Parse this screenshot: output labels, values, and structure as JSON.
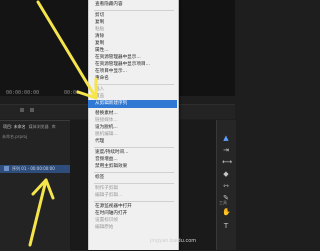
{
  "monitor": {
    "timecode_left": "00:00:00:00",
    "timecode_right": "00:00"
  },
  "project_panel": {
    "tabs": [
      "项目: 未命名",
      "媒体浏览器",
      "库"
    ],
    "project_file": "未命名.prproj",
    "sequence_label": "序列 01 - 00:00:00:00"
  },
  "context_menu": {
    "items": [
      {
        "label": "查看隐藏内容",
        "disabled": false
      },
      {
        "label": "剪切",
        "disabled": false
      },
      {
        "label": "复制",
        "disabled": false
      },
      {
        "label": "粘贴",
        "disabled": true
      },
      {
        "label": "清除",
        "disabled": false
      },
      {
        "label": "复制",
        "disabled": false
      },
      {
        "label": "属性...",
        "disabled": false
      },
      {
        "label": "在资源管理器中显示...",
        "disabled": false
      },
      {
        "label": "在资源管理器中显示项目...",
        "disabled": false
      },
      {
        "label": "在项目中显示...",
        "disabled": false
      },
      {
        "label": "重命名",
        "disabled": false
      },
      {
        "label": "插入",
        "disabled": true
      },
      {
        "label": "覆盖",
        "disabled": true
      },
      {
        "label": "从剪辑新建序列",
        "disabled": false,
        "highlight": true
      },
      {
        "label": "替换素材...",
        "disabled": false
      },
      {
        "label": "链接媒体...",
        "disabled": true
      },
      {
        "label": "设为脱机...",
        "disabled": false
      },
      {
        "label": "脱机编辑...",
        "disabled": true
      },
      {
        "label": "代理",
        "disabled": false
      },
      {
        "label": "速度/持续时间...",
        "disabled": false
      },
      {
        "label": "音频增益...",
        "disabled": false
      },
      {
        "label": "禁用主剪辑效果",
        "disabled": false
      },
      {
        "label": "标签",
        "disabled": false
      },
      {
        "label": "制作子剪辑",
        "disabled": true
      },
      {
        "label": "编辑子剪辑...",
        "disabled": true
      },
      {
        "label": "在源监视器中打开",
        "disabled": false
      },
      {
        "label": "在时间轴内打开",
        "disabled": false
      },
      {
        "label": "设置标识帧",
        "disabled": true
      },
      {
        "label": "编辑原始",
        "disabled": true
      }
    ]
  },
  "tools": {
    "label": "工具"
  },
  "watermark": "jingyan.baidu.com",
  "colors": {
    "highlight": "#2f78d3",
    "arrow": "#f5e54a",
    "selection": "#2f4d7a"
  },
  "icons": [
    "select-tool-icon",
    "track-select-icon",
    "ripple-edit-icon",
    "razor-icon",
    "slip-icon",
    "pen-icon",
    "hand-icon",
    "type-icon"
  ]
}
